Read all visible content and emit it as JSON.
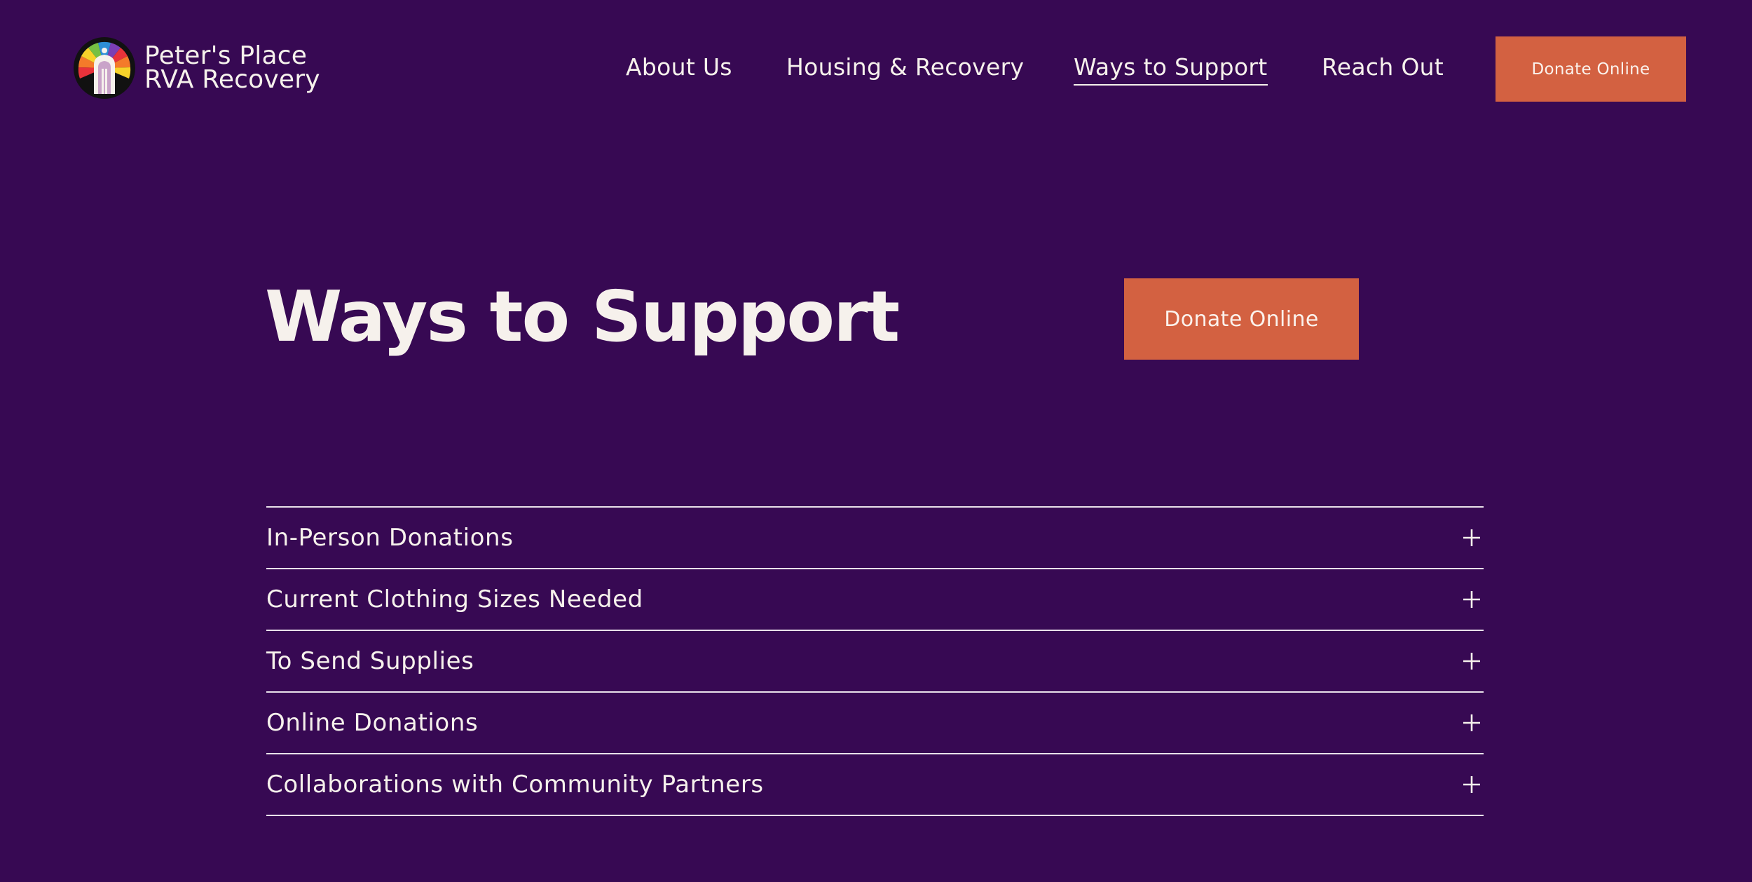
{
  "header": {
    "logo": {
      "line1": "Peter's Place",
      "line2": "RVA Recovery"
    },
    "nav": [
      {
        "label": "About Us",
        "active": false
      },
      {
        "label": "Housing & Recovery",
        "active": false
      },
      {
        "label": "Ways to Support",
        "active": true
      },
      {
        "label": "Reach Out",
        "active": false
      }
    ],
    "donate_label": "Donate Online"
  },
  "hero": {
    "title": "Ways to Support",
    "donate_label": "Donate Online"
  },
  "accordion": [
    {
      "label": "In-Person Donations",
      "icon": "plus-icon"
    },
    {
      "label": "Current Clothing Sizes Needed",
      "icon": "plus-icon"
    },
    {
      "label": "To Send Supplies",
      "icon": "plus-icon"
    },
    {
      "label": "Online Donations",
      "icon": "plus-icon"
    },
    {
      "label": "Collaborations with Community Partners",
      "icon": "plus-icon"
    }
  ],
  "colors": {
    "background": "#370953",
    "accent": "#d36141",
    "text": "#f6f1ec"
  }
}
